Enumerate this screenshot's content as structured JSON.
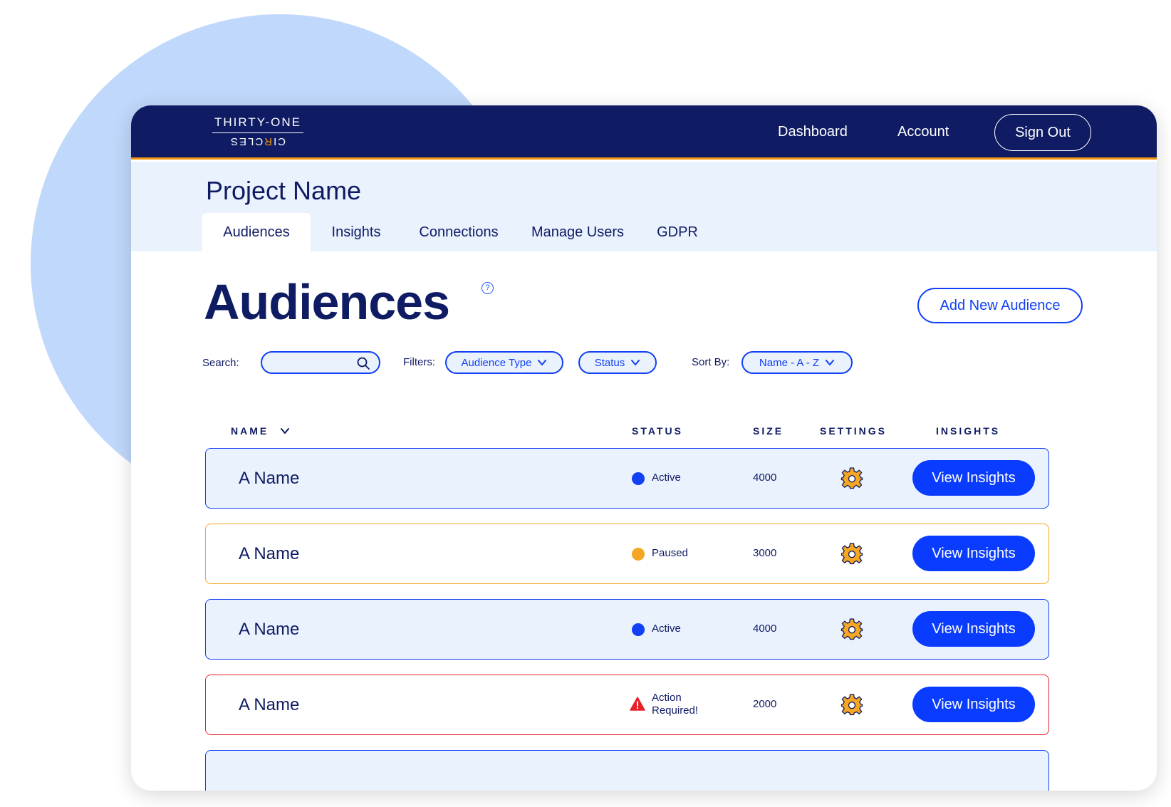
{
  "brand": {
    "logo_top": "THIRTY-ONE",
    "logo_bottom_pre": "CI",
    "logo_bottom_accent": "R",
    "logo_bottom_post": "CLES"
  },
  "nav": {
    "dashboard": "Dashboard",
    "account": "Account",
    "signout": "Sign Out"
  },
  "project": {
    "title": "Project Name",
    "tabs": [
      "Audiences",
      "Insights",
      "Connections",
      "Manage Users",
      "GDPR"
    ],
    "active_tab": "Audiences"
  },
  "page": {
    "heading": "Audiences",
    "help_glyph": "?",
    "add_button": "Add New Audience"
  },
  "controls": {
    "search_label": "Search:",
    "search_value": "",
    "filters_label": "Filters:",
    "filter_type": "Audience Type",
    "filter_status": "Status",
    "sort_label": "Sort By:",
    "sort_value": "Name - A - Z"
  },
  "table": {
    "columns": [
      "NAME",
      "STATUS",
      "SIZE",
      "SETTINGS",
      "INSIGHTS"
    ],
    "rows": [
      {
        "name": "A Name",
        "status": "Active",
        "size": "4000",
        "action": "View Insights"
      },
      {
        "name": "A Name",
        "status": "Paused",
        "size": "3000",
        "action": "View Insights"
      },
      {
        "name": "A Name",
        "status": "Active",
        "size": "4000",
        "action": "View Insights"
      },
      {
        "name": "A Name",
        "status_line1": "Action",
        "status_line2": "Required!",
        "size": "2000",
        "action": "View Insights"
      }
    ]
  },
  "colors": {
    "navy": "#0f1b63",
    "accent_blue": "#1240f5",
    "button_blue": "#0a3cff",
    "orange": "#f5a623",
    "red": "#e8212b",
    "light_blue_bg": "#eaf2fe",
    "circle_bg": "#c0d8fb"
  },
  "icons": [
    "search-icon",
    "chevron-down-icon",
    "help-icon",
    "gear-icon",
    "warning-icon"
  ]
}
